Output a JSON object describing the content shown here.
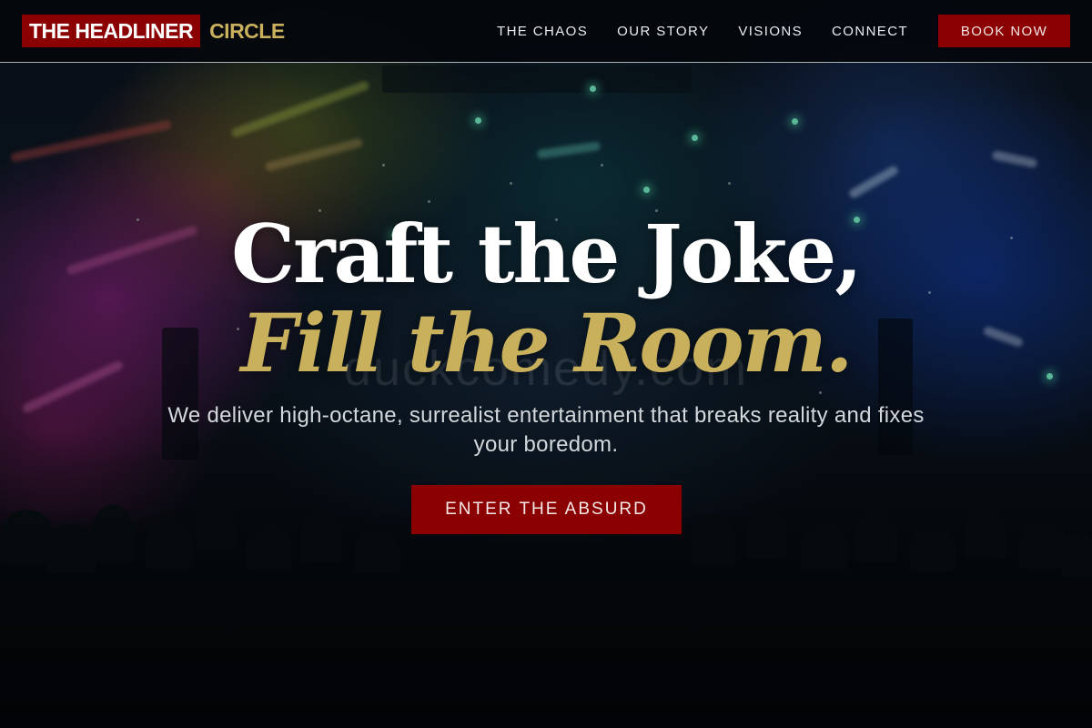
{
  "brand": {
    "name_main": "THE HEADLINER",
    "name_accent": "CIRCLE"
  },
  "nav": {
    "items": [
      "THE CHAOS",
      "OUR STORY",
      "VISIONS",
      "CONNECT"
    ],
    "cta_label": "BOOK NOW"
  },
  "hero": {
    "headline_line1": "Craft the Joke,",
    "headline_line2": "Fill the Room.",
    "subtext": "We deliver high-octane, surrealist entertainment that breaks reality and fixes your boredom.",
    "cta_label": "ENTER THE ABSURD",
    "watermark": "duckcomedy.com"
  },
  "colors": {
    "brand_red": "#8b0000",
    "accent_gold": "#c9b05d",
    "header_bg": "#03060a",
    "text_light": "#e9ecef"
  }
}
